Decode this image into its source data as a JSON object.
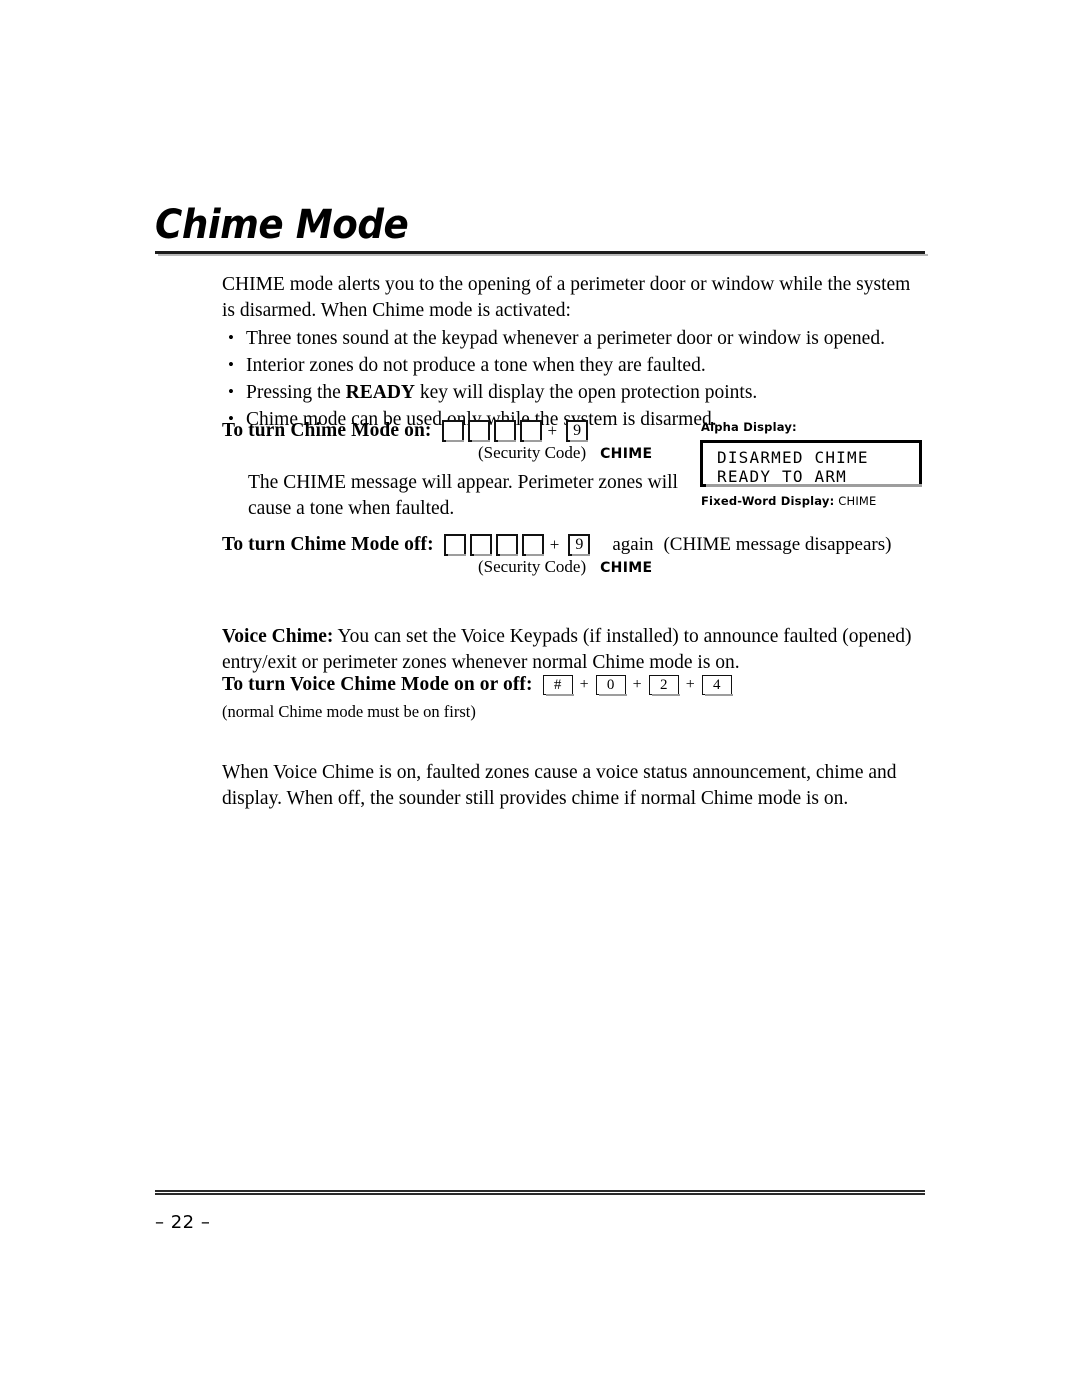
{
  "document": {
    "title": "Chime Mode",
    "page_number": "– 22 –"
  },
  "intro": {
    "paragraph": "CHIME mode alerts you to the opening of a perimeter door or window while the system is disarmed. When Chime mode is activated:"
  },
  "bullets": [
    {
      "text_before": "Three tones sound at the keypad whenever a perimeter door or window is opened.",
      "bold": "",
      "text_after": ""
    },
    {
      "text_before": "Interior zones do not produce a tone when they are faulted.",
      "bold": "",
      "text_after": ""
    },
    {
      "text_before": "Pressing the ",
      "bold": "READY",
      "text_after": " key will display the open protection points."
    },
    {
      "text_before": "Chime mode can be used only while the system is disarmed.",
      "bold": "",
      "text_after": ""
    }
  ],
  "chime_on": {
    "label": "To turn Chime Mode on:",
    "keys": [
      "",
      "",
      "",
      ""
    ],
    "plus": "+",
    "code_key": "9",
    "caption_code": "(Security Code)",
    "caption_key": "CHIME",
    "note": "The CHIME message will appear. Perimeter zones will cause a tone when faulted."
  },
  "alpha_display": {
    "label": "Alpha Display:",
    "line1": "DISARMED CHIME",
    "line2": "READY TO ARM",
    "fixed_label": "Fixed-Word Display:",
    "fixed_value": "CHIME"
  },
  "chime_off": {
    "label": "To turn Chime Mode off:",
    "keys": [
      "",
      "",
      "",
      ""
    ],
    "plus": "+",
    "code_key": "9",
    "again": "again",
    "result": "(CHIME message disappears)",
    "caption_code": "(Security Code)",
    "caption_key": "CHIME"
  },
  "voice_chime": {
    "intro_bold": "Voice Chime:",
    "intro_text": " You can set the Voice Keypads (if installed) to announce faulted (opened) entry/exit or perimeter zones whenever normal Chime mode is on.",
    "label": "To turn Voice Chime Mode on or off:",
    "sequence": [
      "#",
      "0",
      "2",
      "4"
    ],
    "plus": "+",
    "note": "(normal Chime mode must be on first)",
    "closing": "When Voice Chime is on, faulted zones cause a voice status announcement, chime and display. When off, the sounder still provides chime if normal Chime mode is on."
  }
}
